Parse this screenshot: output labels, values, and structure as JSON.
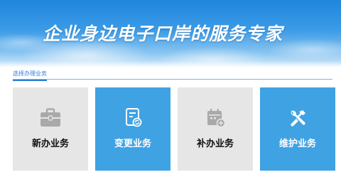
{
  "banner": {
    "title": "企业身边电子口岸的服务专家"
  },
  "section": {
    "tab_label": "选择办理业务"
  },
  "cards": [
    {
      "label": "新办业务",
      "icon": "briefcase-icon",
      "style": "gray"
    },
    {
      "label": "变更业务",
      "icon": "edit-document-icon",
      "style": "blue"
    },
    {
      "label": "补办业务",
      "icon": "calendar-add-icon",
      "style": "gray"
    },
    {
      "label": "维护业务",
      "icon": "tools-icon",
      "style": "blue"
    }
  ],
  "colors": {
    "accent_blue": "#3fa2e3",
    "card_gray": "#e6e6e6",
    "icon_gray": "#a9a9a9",
    "tab_blue": "#2c7fd6"
  }
}
